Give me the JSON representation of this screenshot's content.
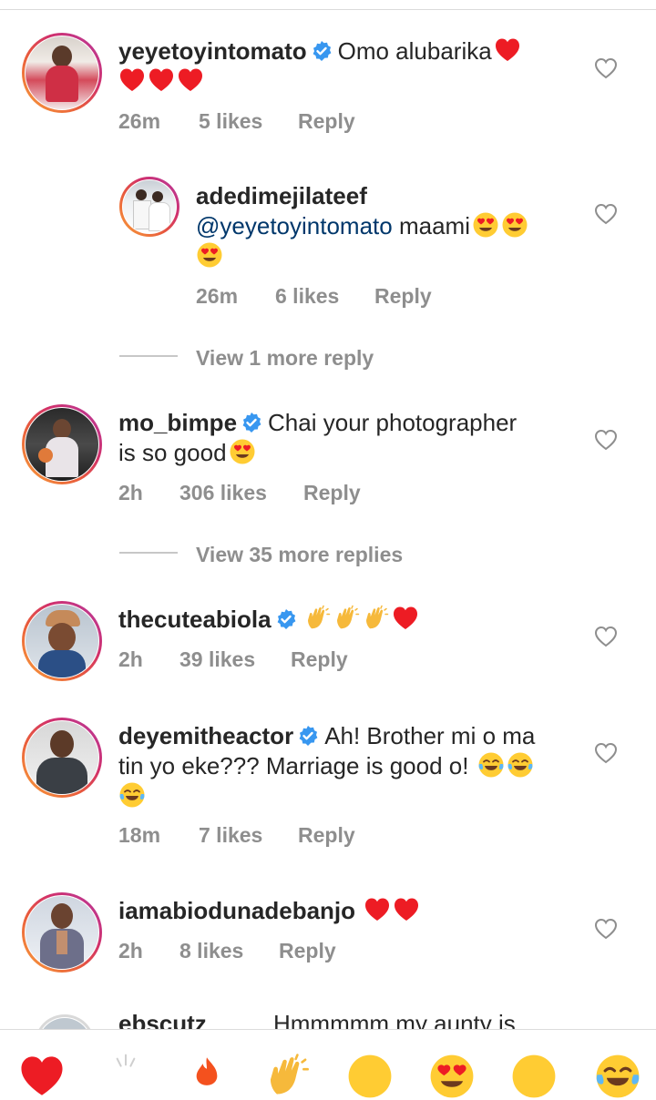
{
  "comments": [
    {
      "username": "yeyetoyintomato",
      "verified": true,
      "text_parts": [
        "Omo alubarika"
      ],
      "time": "26m",
      "likes": "5 likes",
      "reply": "Reply"
    },
    {
      "username": "adedimejilateef",
      "verified": false,
      "mention": "@yeyetoyintomato",
      "text_parts": [
        "maami"
      ],
      "time": "26m",
      "likes": "6 likes",
      "reply": "Reply"
    },
    {
      "username": "mo_bimpe",
      "verified": true,
      "text_parts": [
        "Chai your photographer",
        "is so good"
      ],
      "time": "2h",
      "likes": "306 likes",
      "reply": "Reply"
    },
    {
      "username": "thecuteabiola",
      "verified": true,
      "text_parts": [],
      "time": "2h",
      "likes": "39 likes",
      "reply": "Reply"
    },
    {
      "username": "deyemitheactor",
      "verified": true,
      "text_parts": [
        "Ah! Brother mi o ma",
        "tin yo eke??? Marriage is good o!"
      ],
      "time": "18m",
      "likes": "7 likes",
      "reply": "Reply"
    },
    {
      "username": "iamabiodunadebanjo",
      "verified": false,
      "text_parts": [],
      "time": "2h",
      "likes": "8 likes",
      "reply": "Reply"
    },
    {
      "username": "ebscutz",
      "verified": false,
      "text_parts": [
        "Hmmmmm my aunty is"
      ]
    }
  ],
  "view_more": {
    "one": "View 1 more reply",
    "thirtyfive": "View 35 more replies"
  },
  "colors": {
    "text": "#262626",
    "meta": "#8e8e8e",
    "mention": "#00376b",
    "verified": "#3897f0",
    "heart_red": "#ed1c24"
  },
  "icons": [
    "heart-outline-icon",
    "verified-badge-icon",
    "heart-emoji",
    "heart-eyes-emoji",
    "clap-emoji",
    "tears-of-joy-emoji"
  ]
}
